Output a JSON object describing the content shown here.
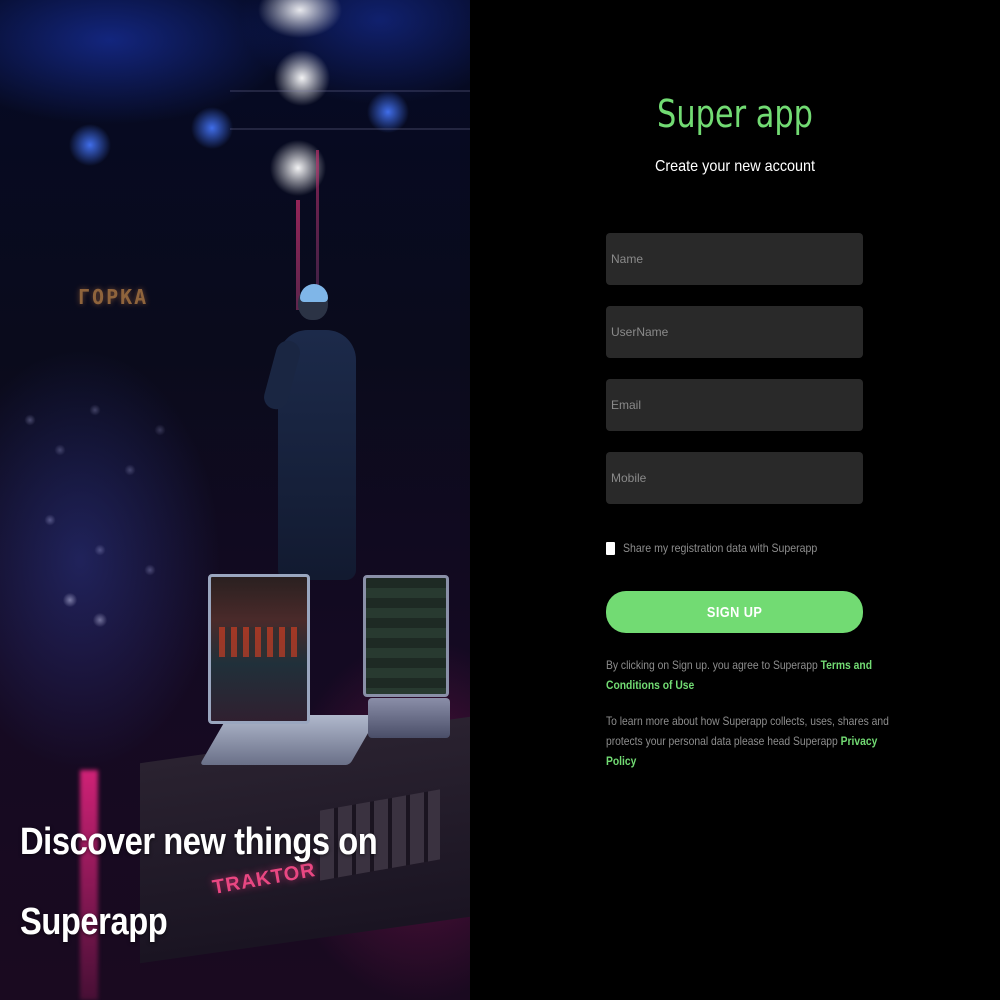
{
  "hero": {
    "headline": "Discover new things on Superapp",
    "venue_sign": "ГОРКА",
    "brand_mark": "TRAKTOR"
  },
  "panel": {
    "brand": "Super app",
    "subtitle": "Create your new account",
    "fields": {
      "name": {
        "placeholder": "Name",
        "value": ""
      },
      "username": {
        "placeholder": "UserName",
        "value": ""
      },
      "email": {
        "placeholder": "Email",
        "value": ""
      },
      "mobile": {
        "placeholder": "Mobile",
        "value": ""
      }
    },
    "consent": {
      "label": "Share my registration data with Superapp",
      "checked": false
    },
    "signup_label": "SIGN UP",
    "terms": {
      "prefix": "By clicking on Sign up. you agree to Superapp ",
      "link": "Terms and Conditions of Use"
    },
    "privacy": {
      "prefix": "To learn more about how Superapp collects, uses, shares and protects your personal data please head Superapp ",
      "link": "Privacy Policy"
    }
  },
  "colors": {
    "accent": "#72db73",
    "field_bg": "#292929",
    "panel_bg": "#000000",
    "muted_text": "#8d8d8d"
  }
}
